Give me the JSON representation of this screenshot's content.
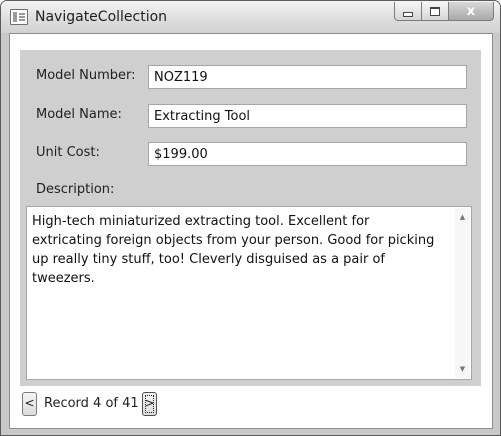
{
  "window": {
    "title": "NavigateCollection",
    "buttons": {
      "minimize": "minimize",
      "maximize": "maximize",
      "close": "x"
    }
  },
  "form": {
    "model_number": {
      "label": "Model Number:",
      "value": "NOZ119"
    },
    "model_name": {
      "label": "Model Name:",
      "value": "Extracting Tool"
    },
    "unit_cost": {
      "label": "Unit Cost:",
      "value": "$199.00"
    },
    "description": {
      "label": "Description:",
      "value": "High-tech miniaturized extracting tool. Excellent for extricating foreign objects from your person. Good for picking up really tiny stuff, too! Cleverly disguised as a pair of tweezers."
    }
  },
  "navigation": {
    "prev_label": "<",
    "next_label": ">",
    "record_text": "Record 4 of 41"
  },
  "icons": {
    "app": "window-icon",
    "scroll_up": "scroll-up-arrow-icon",
    "scroll_down": "scroll-down-arrow-icon"
  }
}
